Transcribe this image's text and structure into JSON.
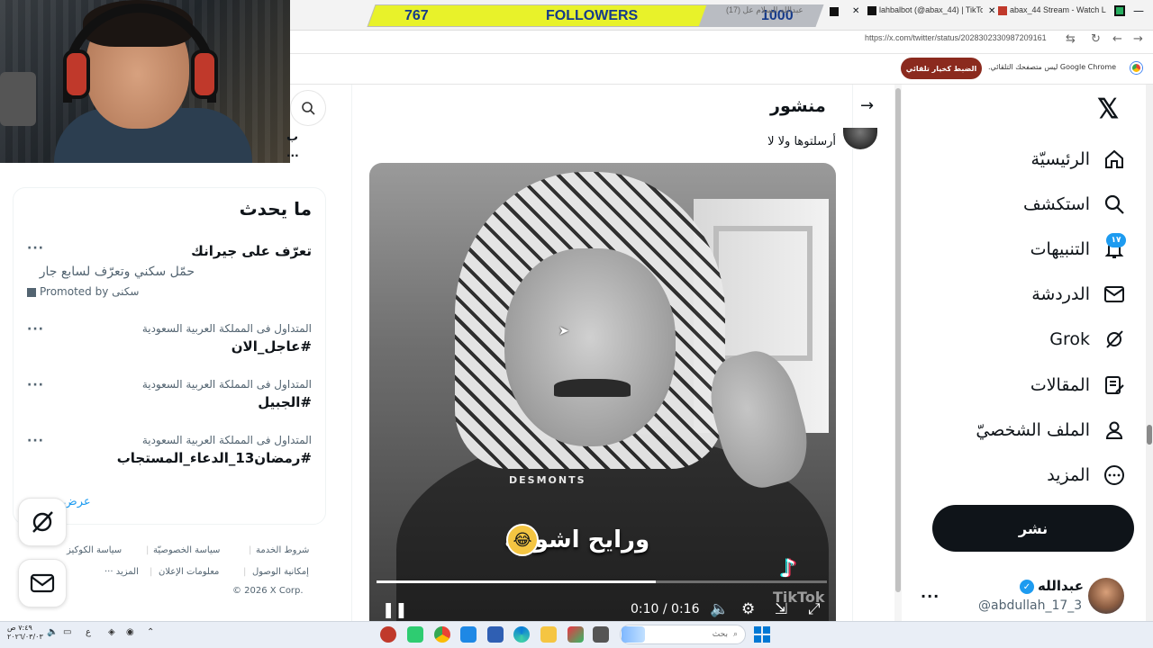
{
  "stream_overlay": {
    "followers_current": "767",
    "followers_label": "FOLLOWERS",
    "followers_goal": "1000"
  },
  "browser": {
    "tabs": [
      {
        "label": "abax_44 Stream - Watch Live on"
      },
      {
        "label": "lahbalbot (@abax_44) | TikTok"
      },
      {
        "label": "(17) عبدالله السلام عل"
      }
    ],
    "url": "https://x.com/twitter/status/2028302330987209161",
    "notice_text": "Google Chrome ليس متصفحك التلقائي.",
    "notice_button": "الضبط كخيار تلقائي"
  },
  "nav": {
    "items": [
      {
        "label": "الرئيسيّة",
        "icon": "home-icon"
      },
      {
        "label": "استكشف",
        "icon": "search-icon"
      },
      {
        "label": "التنبيهات",
        "icon": "bell-icon"
      },
      {
        "label": "الدردشة",
        "icon": "mail-icon"
      },
      {
        "label": "Grok",
        "icon": "grok-icon"
      },
      {
        "label": "المقالات",
        "icon": "articles-icon"
      },
      {
        "label": "الملف الشخصيّ",
        "icon": "profile-icon"
      },
      {
        "label": "المزيد",
        "icon": "more-circle-icon"
      }
    ],
    "notifications_badge": "١٧",
    "post_button": "نشر",
    "account": {
      "name": "عبدالله",
      "handle": "@abdullah_17_3"
    }
  },
  "post": {
    "header_title": "منشور",
    "text": "أرسلتوها ولا لا",
    "video": {
      "watermark": "DESMONTS",
      "caption": "ورايح اشوفه",
      "tiktok_watermark": "TikTok",
      "time_current": "0:10",
      "time_total": "0:16",
      "time_display": "0:10 / 0:16",
      "progress": 0.62
    }
  },
  "trends": {
    "title": "ما يحدث",
    "promo": {
      "title": "تعرّف على جيرانك",
      "description": "حمّل سكني وتعرّف لسابع جار",
      "promoted_by": "Promoted by سكنى"
    },
    "items": [
      {
        "context": "المتداول فى المملكة العربية السعودية",
        "tag": "#عاجل_الان"
      },
      {
        "context": "المتداول فى المملكة العربية السعودية",
        "tag": "#الجبيل"
      },
      {
        "context": "المتداول فى المملكة العربية السعودية",
        "tag": "#رمضان13_الدعاء_المستجاب"
      }
    ],
    "show_more": "عرض"
  },
  "footer": {
    "links": [
      "شروط الخدمة",
      "سياسة الخصوصيّة",
      "سياسة الكوكيز",
      "إمكانية الوصول",
      "معلومات الإعلان",
      "··· المزيد"
    ],
    "copyright": "© 2026 X Corp."
  },
  "taskbar": {
    "search_placeholder": "بحث",
    "time": "٧:٤٩ ص",
    "date": "٢٠٢٦/٠٣/٠٣"
  }
}
